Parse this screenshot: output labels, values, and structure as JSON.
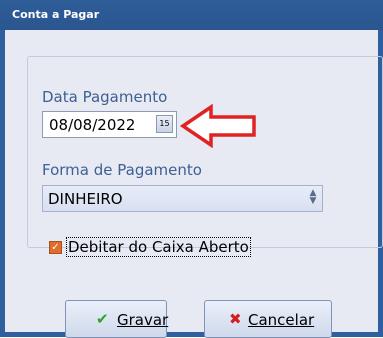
{
  "window": {
    "title": "Conta a Pagar"
  },
  "form": {
    "date_label": "Data Pagamento",
    "date_value": "08/08/2022",
    "calendar_icon_text": "15",
    "payment_label": "Forma de Pagamento",
    "payment_value": "DINHEIRO",
    "debit_checkbox": {
      "label": "Debitar do Caixa Aberto",
      "checked": true
    }
  },
  "buttons": {
    "save": {
      "label": "Gravar",
      "icon": "check-icon",
      "icon_color": "#2fa329"
    },
    "cancel": {
      "label": "Cancelar",
      "icon": "x-icon",
      "icon_color": "#d11f1f"
    }
  },
  "colors": {
    "accent_arrow": "#e02222",
    "checkbox": "#e06e2a",
    "title_bar": "#2e5d98"
  }
}
